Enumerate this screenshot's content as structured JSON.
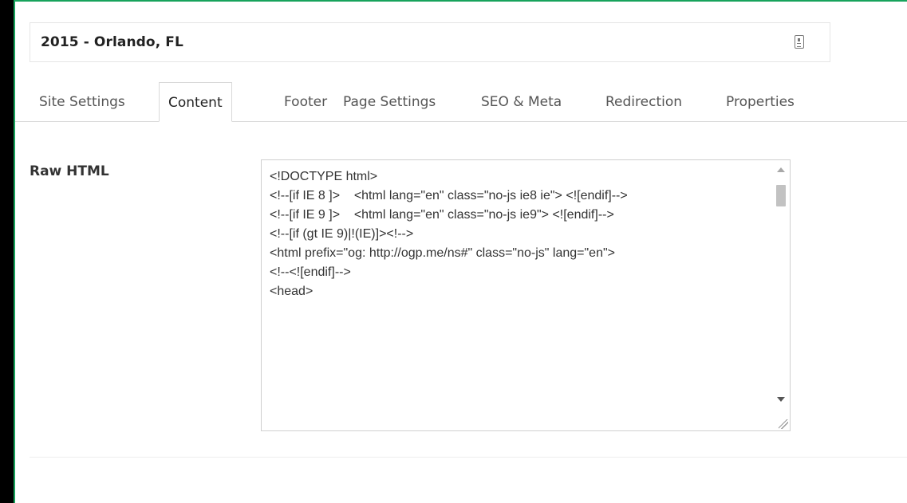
{
  "page": {
    "title": "2015 - Orlando, FL"
  },
  "tabs": [
    {
      "label": "Site Settings",
      "active": false
    },
    {
      "label": "Content",
      "active": true
    },
    {
      "label": "Footer",
      "active": false
    },
    {
      "label": "Page Settings",
      "active": false
    },
    {
      "label": "SEO & Meta",
      "active": false
    },
    {
      "label": "Redirection",
      "active": false
    },
    {
      "label": "Properties",
      "active": false
    }
  ],
  "content": {
    "raw_html_label": "Raw HTML",
    "raw_html_value": "<!DOCTYPE html>\n<!--[if IE 8 ]>    <html lang=\"en\" class=\"no-js ie8 ie\"> <![endif]-->\n<!--[if IE 9 ]>    <html lang=\"en\" class=\"no-js ie9\"> <![endif]-->\n<!--[if (gt IE 9)|!(IE)]><!-->\n<html prefix=\"og: http://ogp.me/ns#\" class=\"no-js\" lang=\"en\">\n<!--<![endif]-->\n<head>"
  },
  "icons": {
    "title_icon": "document-lock-icon",
    "scroll_up": "chevron-up-icon",
    "scroll_down": "chevron-down-icon",
    "resize": "resize-handle-icon"
  },
  "colors": {
    "accent_border": "#17a35c",
    "background": "#ffffff",
    "frame": "#000000"
  }
}
